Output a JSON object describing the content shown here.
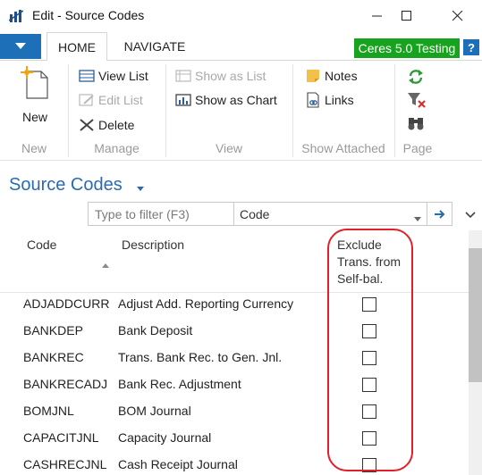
{
  "window": {
    "title": "Edit - Source Codes"
  },
  "tabs": {
    "home": "HOME",
    "navigate": "NAVIGATE"
  },
  "company_badge": "Ceres 5.0 Testing",
  "help_label": "?",
  "ribbon": {
    "new_group": {
      "label": "New",
      "new_button": "New"
    },
    "manage_group": {
      "label": "Manage",
      "view_list": "View List",
      "edit_list": "Edit List",
      "delete": "Delete"
    },
    "view_group": {
      "label": "View",
      "show_as_list": "Show as List",
      "show_as_chart": "Show as Chart"
    },
    "show_attached_group": {
      "label": "Show Attached",
      "notes": "Notes",
      "links": "Links"
    },
    "page_group": {
      "label": "Page"
    }
  },
  "page": {
    "title": "Source Codes",
    "filter_placeholder": "Type to filter (F3)",
    "filter_field": "Code"
  },
  "grid": {
    "columns": {
      "code": "Code",
      "description": "Description",
      "exclude_line1": "Exclude",
      "exclude_line2": "Trans. from",
      "exclude_line3": "Self-bal."
    },
    "rows": [
      {
        "code": "ADJADDCURR",
        "description": "Adjust Add. Reporting Currency",
        "exclude": false
      },
      {
        "code": "BANKDEP",
        "description": "Bank Deposit",
        "exclude": false
      },
      {
        "code": "BANKREC",
        "description": "Trans. Bank Rec. to Gen. Jnl.",
        "exclude": false
      },
      {
        "code": "BANKRECADJ",
        "description": "Bank Rec. Adjustment",
        "exclude": false
      },
      {
        "code": "BOMJNL",
        "description": "BOM Journal",
        "exclude": false
      },
      {
        "code": "CAPACITJNL",
        "description": "Capacity Journal",
        "exclude": false
      },
      {
        "code": "CASHRECJNL",
        "description": "Cash Receipt Journal",
        "exclude": false
      }
    ]
  },
  "colors": {
    "accent_blue": "#1d6fb8",
    "title_blue": "#2a6bb0",
    "badge_green": "#17a31d",
    "highlight_red": "#e0202a"
  }
}
